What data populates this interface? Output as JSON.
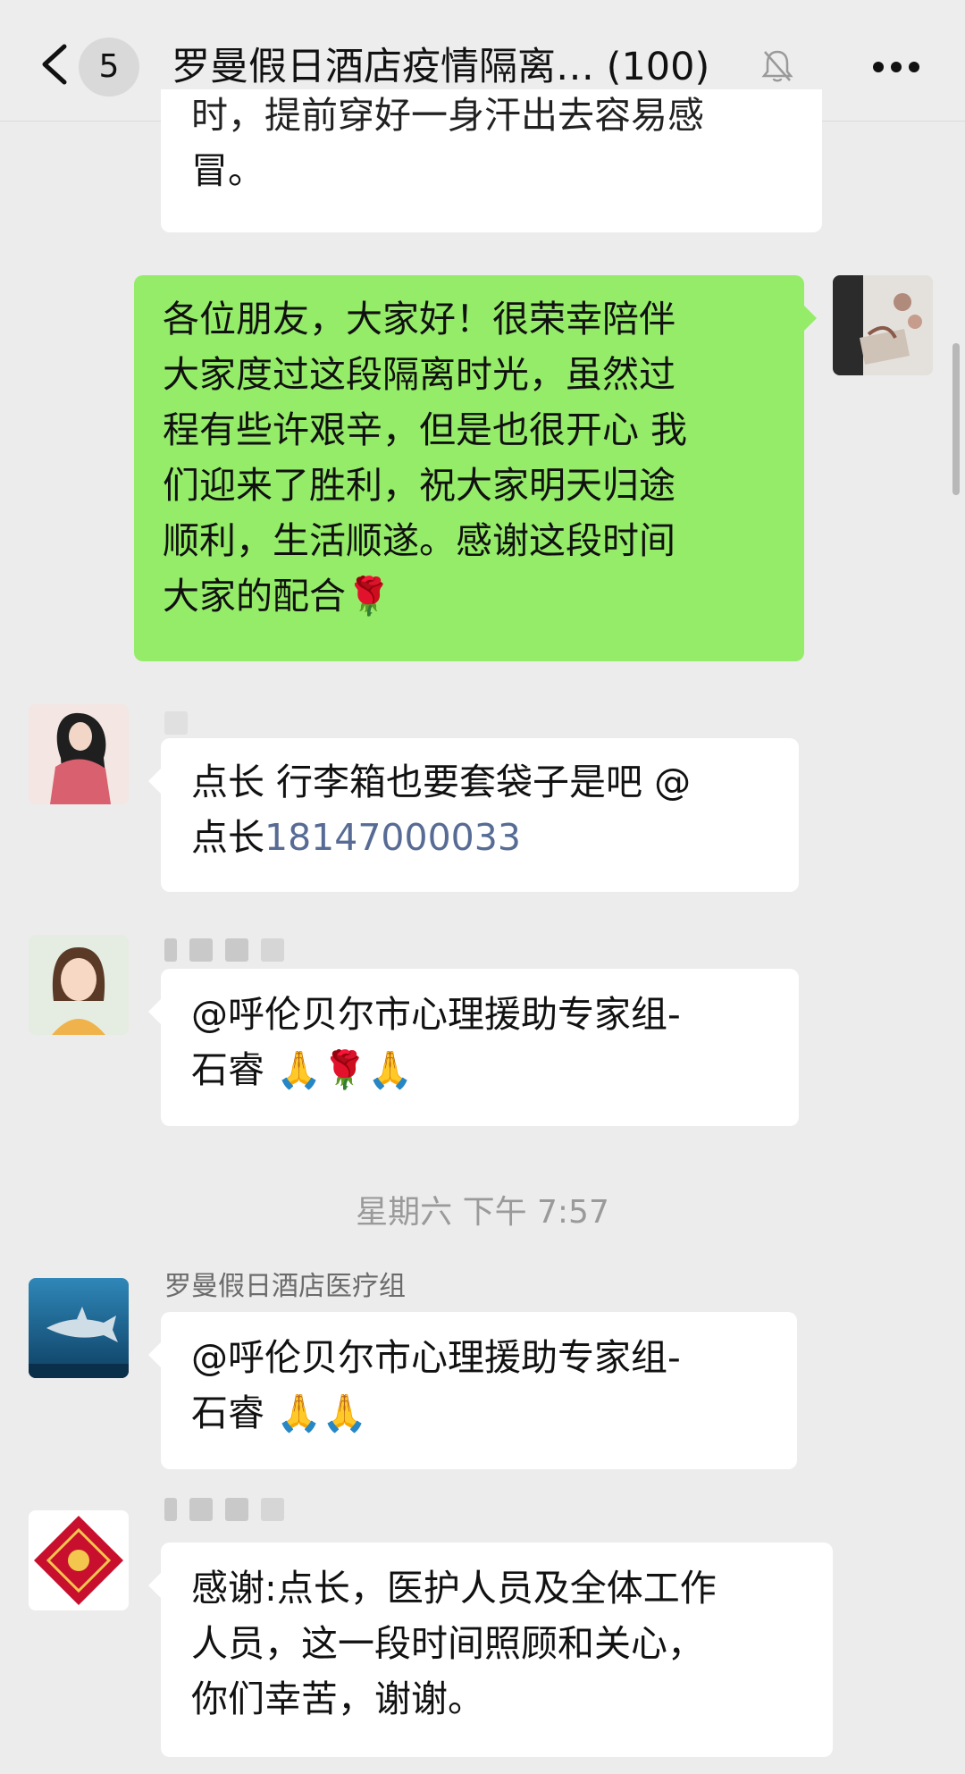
{
  "header": {
    "back_icon": "chevron-left-icon",
    "unread_count": "5",
    "title": "罗曼假日酒店疫情隔离… (100)",
    "mute_icon": "bell-muted-icon",
    "more_icon": "ellipsis-icon"
  },
  "messages": [
    {
      "id": "m0",
      "side": "left",
      "lines": [
        "时，提前穿好一身汗出去容易感",
        "冒。"
      ]
    },
    {
      "id": "m1",
      "side": "right",
      "lines": [
        "各位朋友，大家好！很荣幸陪伴",
        "大家度过这段隔离时光，虽然过",
        "程有些许艰辛，但是也很开心 我",
        "们迎来了胜利，祝大家明天归途",
        "顺利，生活顺遂。感谢这段时间",
        "大家的配合🌹"
      ]
    },
    {
      "id": "m2",
      "side": "left",
      "lines": [
        "点长  行李箱也要套袋子是吧 @",
        "点长"
      ],
      "mention_number": "18147000033"
    },
    {
      "id": "m3",
      "side": "left",
      "lines": [
        "@呼伦贝尔市心理援助专家组-",
        "石睿 🙏🌹🙏"
      ]
    },
    {
      "id": "m4",
      "side": "left",
      "sender": "罗曼假日酒店医疗组",
      "lines": [
        "@呼伦贝尔市心理援助专家组-",
        "石睿 🙏🙏"
      ]
    },
    {
      "id": "m5",
      "side": "left",
      "lines": [
        "感谢:点长，医护人员及全体工作",
        "人员，这一段时间照顾和关心，",
        "你们幸苦，谢谢。"
      ]
    }
  ],
  "timestamp": "星期六 下午 7:57",
  "colors": {
    "green_bubble": "#95ec69",
    "background": "#ececec",
    "link": "#576b95"
  }
}
